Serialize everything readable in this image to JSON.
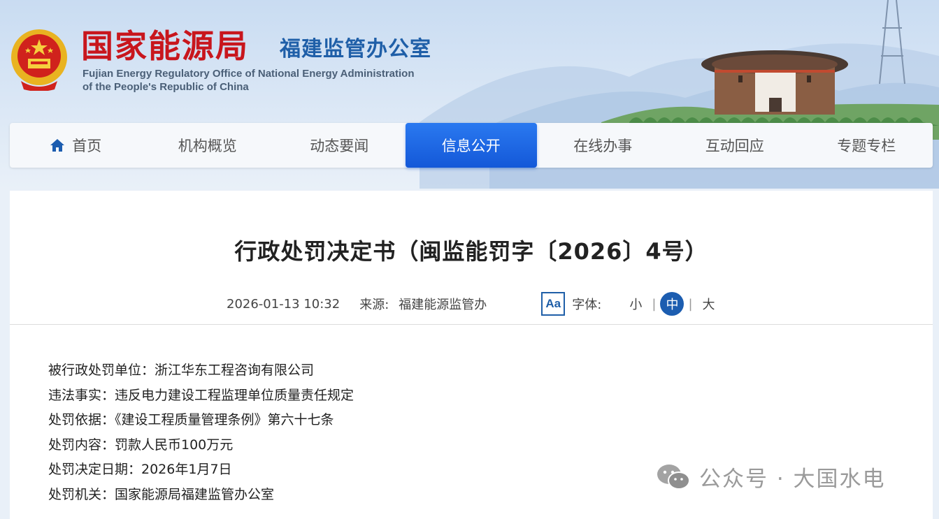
{
  "header": {
    "org_name": "国家能源局",
    "office_name": "福建监管办公室",
    "english_line1": "Fujian Energy Regulatory Office of National Energy Administration",
    "english_line2": "of the People's Republic of China"
  },
  "nav": {
    "items": [
      {
        "label": "首页",
        "icon": "home-icon"
      },
      {
        "label": "机构概览"
      },
      {
        "label": "动态要闻"
      },
      {
        "label": "信息公开",
        "active": true
      },
      {
        "label": "在线办事"
      },
      {
        "label": "互动回应"
      },
      {
        "label": "专题专栏"
      }
    ]
  },
  "article": {
    "title": "行政处罚决定书（闽监能罚字〔2026〕4号）",
    "datetime": "2026-01-13 10:32",
    "source_label": "来源:",
    "source_value": "福建能源监管办",
    "font_icon_text": "Aa",
    "font_label": "字体:",
    "font_sizes": [
      "小",
      "中",
      "大"
    ],
    "font_sizes_selected": "中",
    "separator": "|",
    "lines": [
      "被行政处罚单位：浙江华东工程咨询有限公司",
      "违法事实：违反电力建设工程监理单位质量责任规定",
      "处罚依据：《建设工程质量管理条例》第六十七条",
      "处罚内容：罚款人民币100万元",
      "处罚决定日期：2026年1月7日",
      "处罚机关：国家能源局福建监管办公室"
    ]
  },
  "watermark": {
    "icon": "wechat-icon",
    "text": "公众号 · 大国水电"
  },
  "colors": {
    "nav_active": "#1458d8",
    "brand_red": "#c8161d",
    "brand_blue": "#1f5fa8"
  }
}
